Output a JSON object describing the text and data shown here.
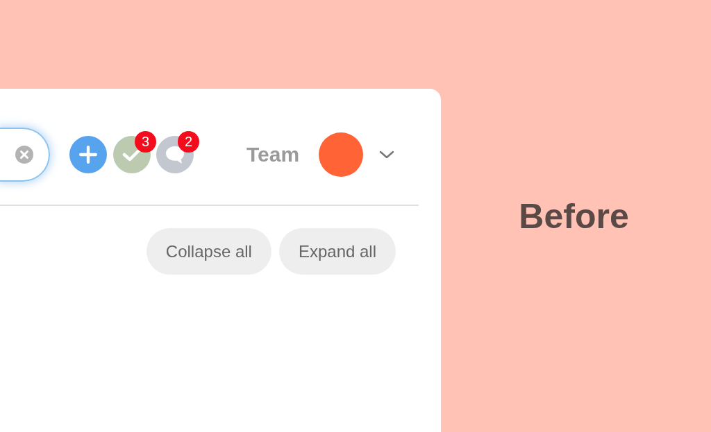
{
  "search": {
    "focused": true
  },
  "actions": [
    {
      "kind": "add"
    },
    {
      "kind": "tasks",
      "badge": "3"
    },
    {
      "kind": "comments",
      "badge": "2"
    }
  ],
  "team_label": "Team",
  "buttons": [
    "Collapse all",
    "Expand all"
  ],
  "side_label": "Before"
}
